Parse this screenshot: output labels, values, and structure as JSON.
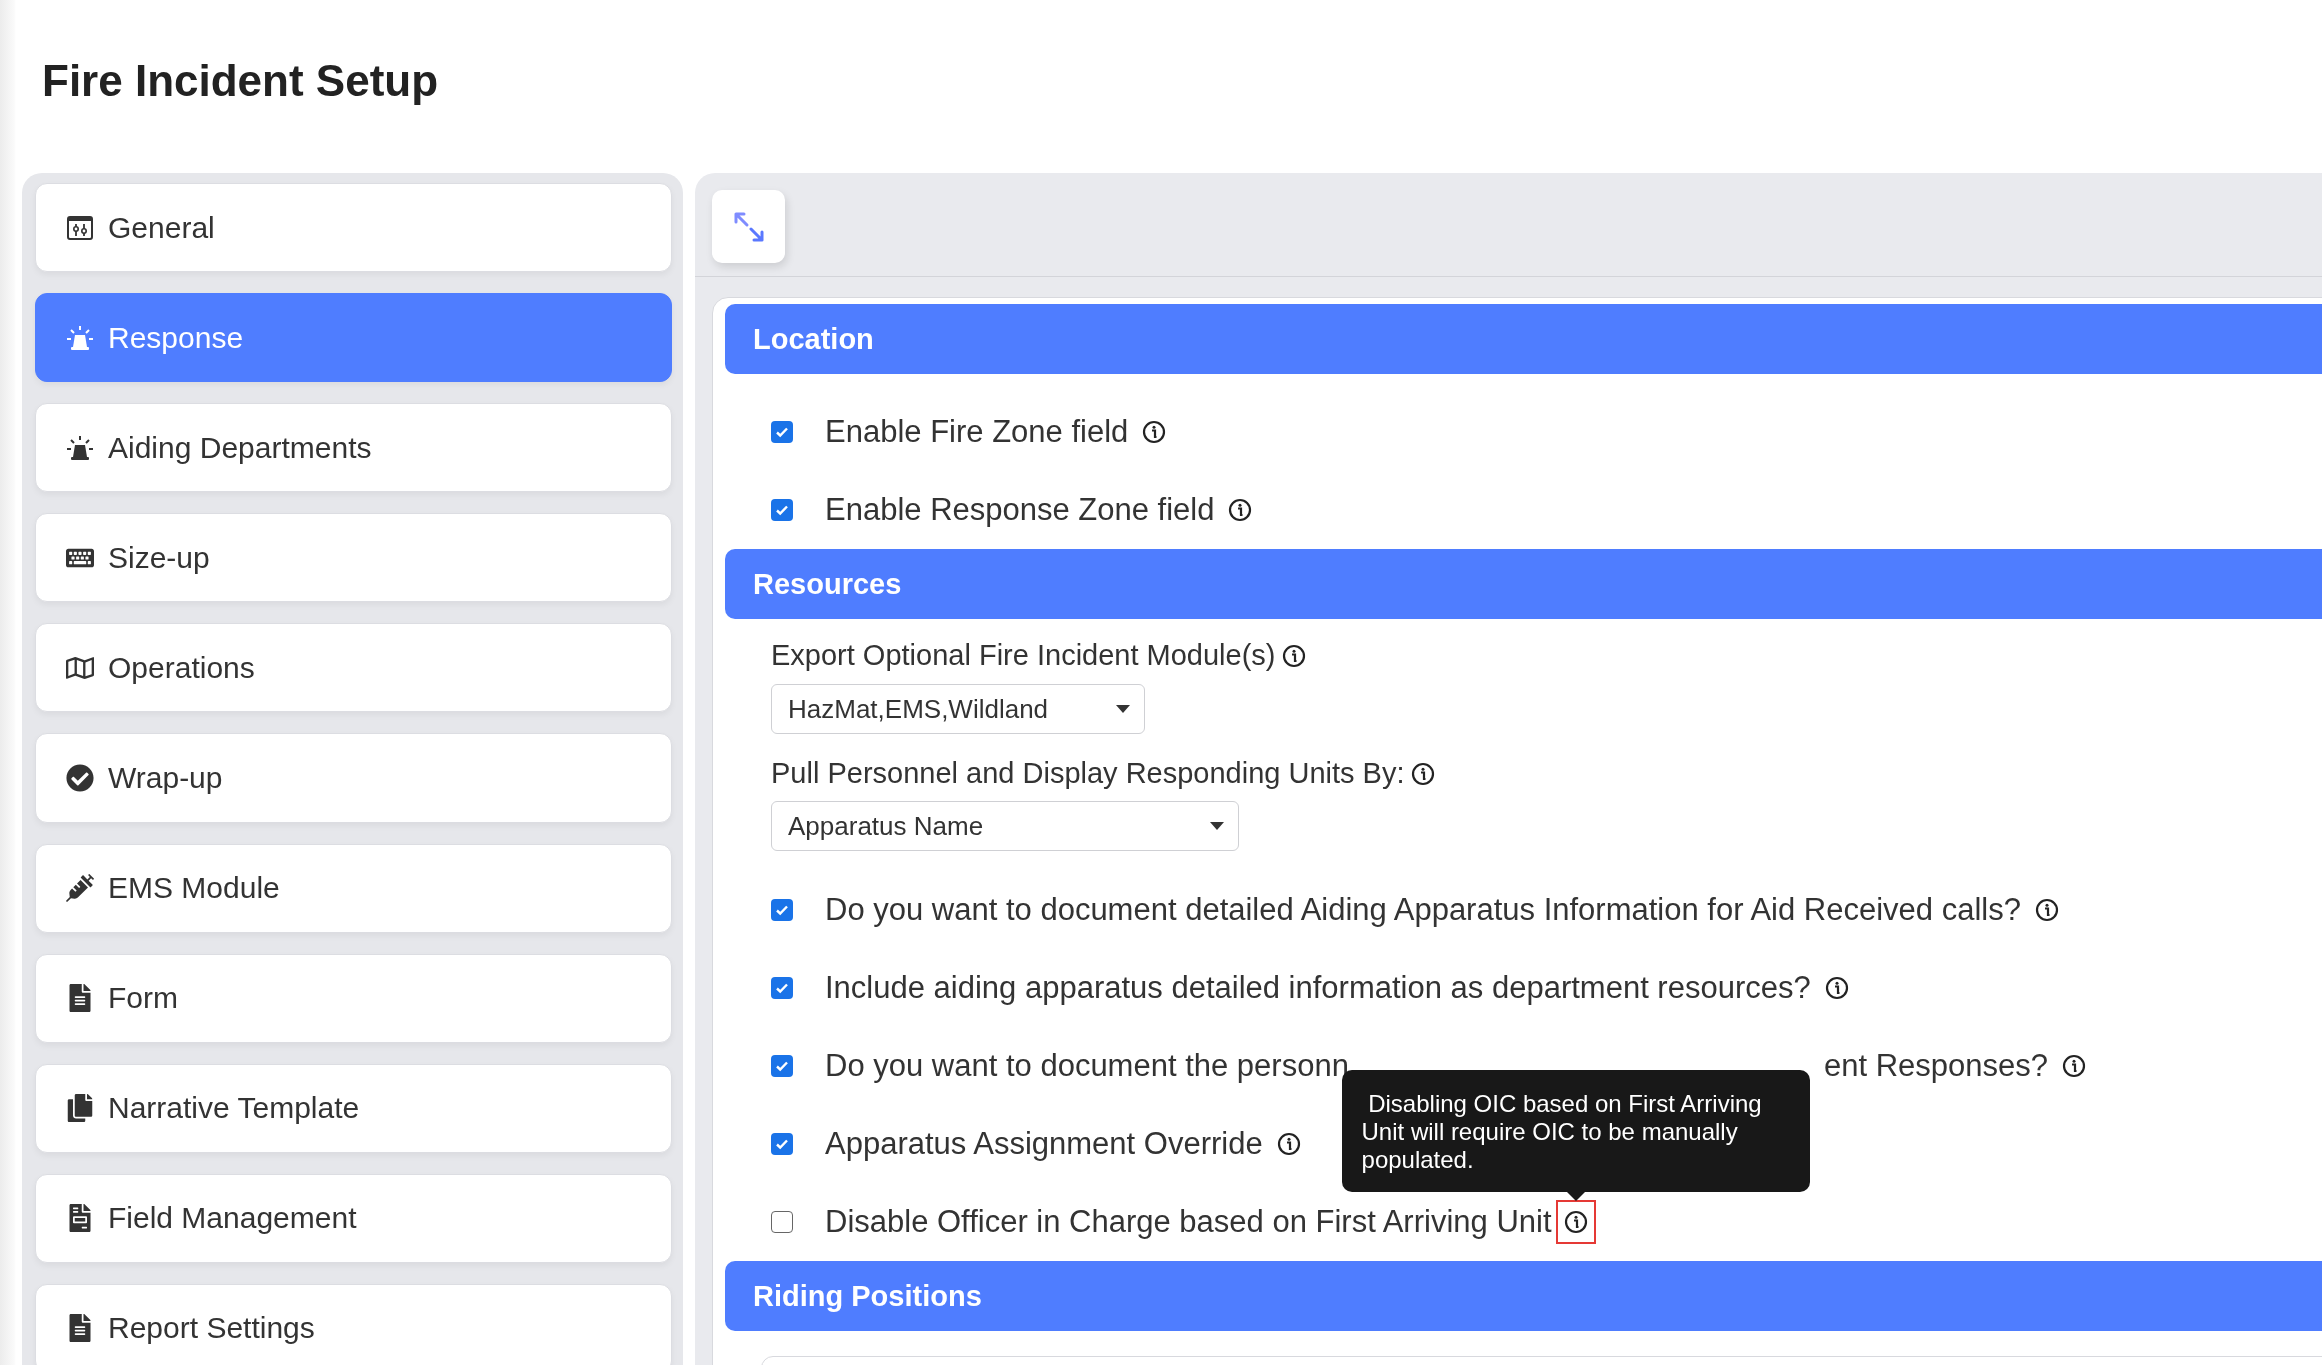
{
  "page": {
    "title": "Fire Incident Setup"
  },
  "sidebar": {
    "items": [
      {
        "label": "General",
        "selected": false
      },
      {
        "label": "Response",
        "selected": true
      },
      {
        "label": "Aiding Departments",
        "selected": false
      },
      {
        "label": "Size-up",
        "selected": false
      },
      {
        "label": "Operations",
        "selected": false
      },
      {
        "label": "Wrap-up",
        "selected": false
      },
      {
        "label": "EMS Module",
        "selected": false
      },
      {
        "label": "Form",
        "selected": false
      },
      {
        "label": "Narrative Template",
        "selected": false
      },
      {
        "label": "Field Management",
        "selected": false
      },
      {
        "label": "Report Settings",
        "selected": false
      }
    ]
  },
  "sections": [
    {
      "title": "Location",
      "fields": [
        {
          "kind": "checkbox",
          "label": "Enable Fire Zone field",
          "checked": true
        },
        {
          "kind": "checkbox",
          "label": "Enable Response Zone field",
          "checked": true
        }
      ]
    },
    {
      "title": "Resources",
      "fields": [
        {
          "kind": "select",
          "label": "Export Optional Fire Incident Module(s)",
          "value": "HazMat,EMS,Wildland"
        },
        {
          "kind": "select",
          "label": "Pull Personnel and Display Responding Units By:",
          "value": "Apparatus Name"
        },
        {
          "kind": "checkbox",
          "label": "Do you want to document detailed Aiding Apparatus Information for Aid Received calls?",
          "checked": true
        },
        {
          "kind": "checkbox",
          "label": "Include aiding apparatus detailed information as department resources?",
          "checked": true
        },
        {
          "kind": "checkbox",
          "label": "Do you want to document the personn",
          "label_end": "ent Responses?",
          "checked": true
        },
        {
          "kind": "checkbox",
          "label": "Apparatus Assignment Override",
          "checked": true
        },
        {
          "kind": "checkbox",
          "label": "Disable Officer in Charge based on First Arriving Unit",
          "checked": false,
          "highlighted": true,
          "tooltip": " Disabling OIC based on First Arriving Unit will require OIC to be manually populated."
        }
      ]
    },
    {
      "title": "Riding Positions"
    }
  ]
}
